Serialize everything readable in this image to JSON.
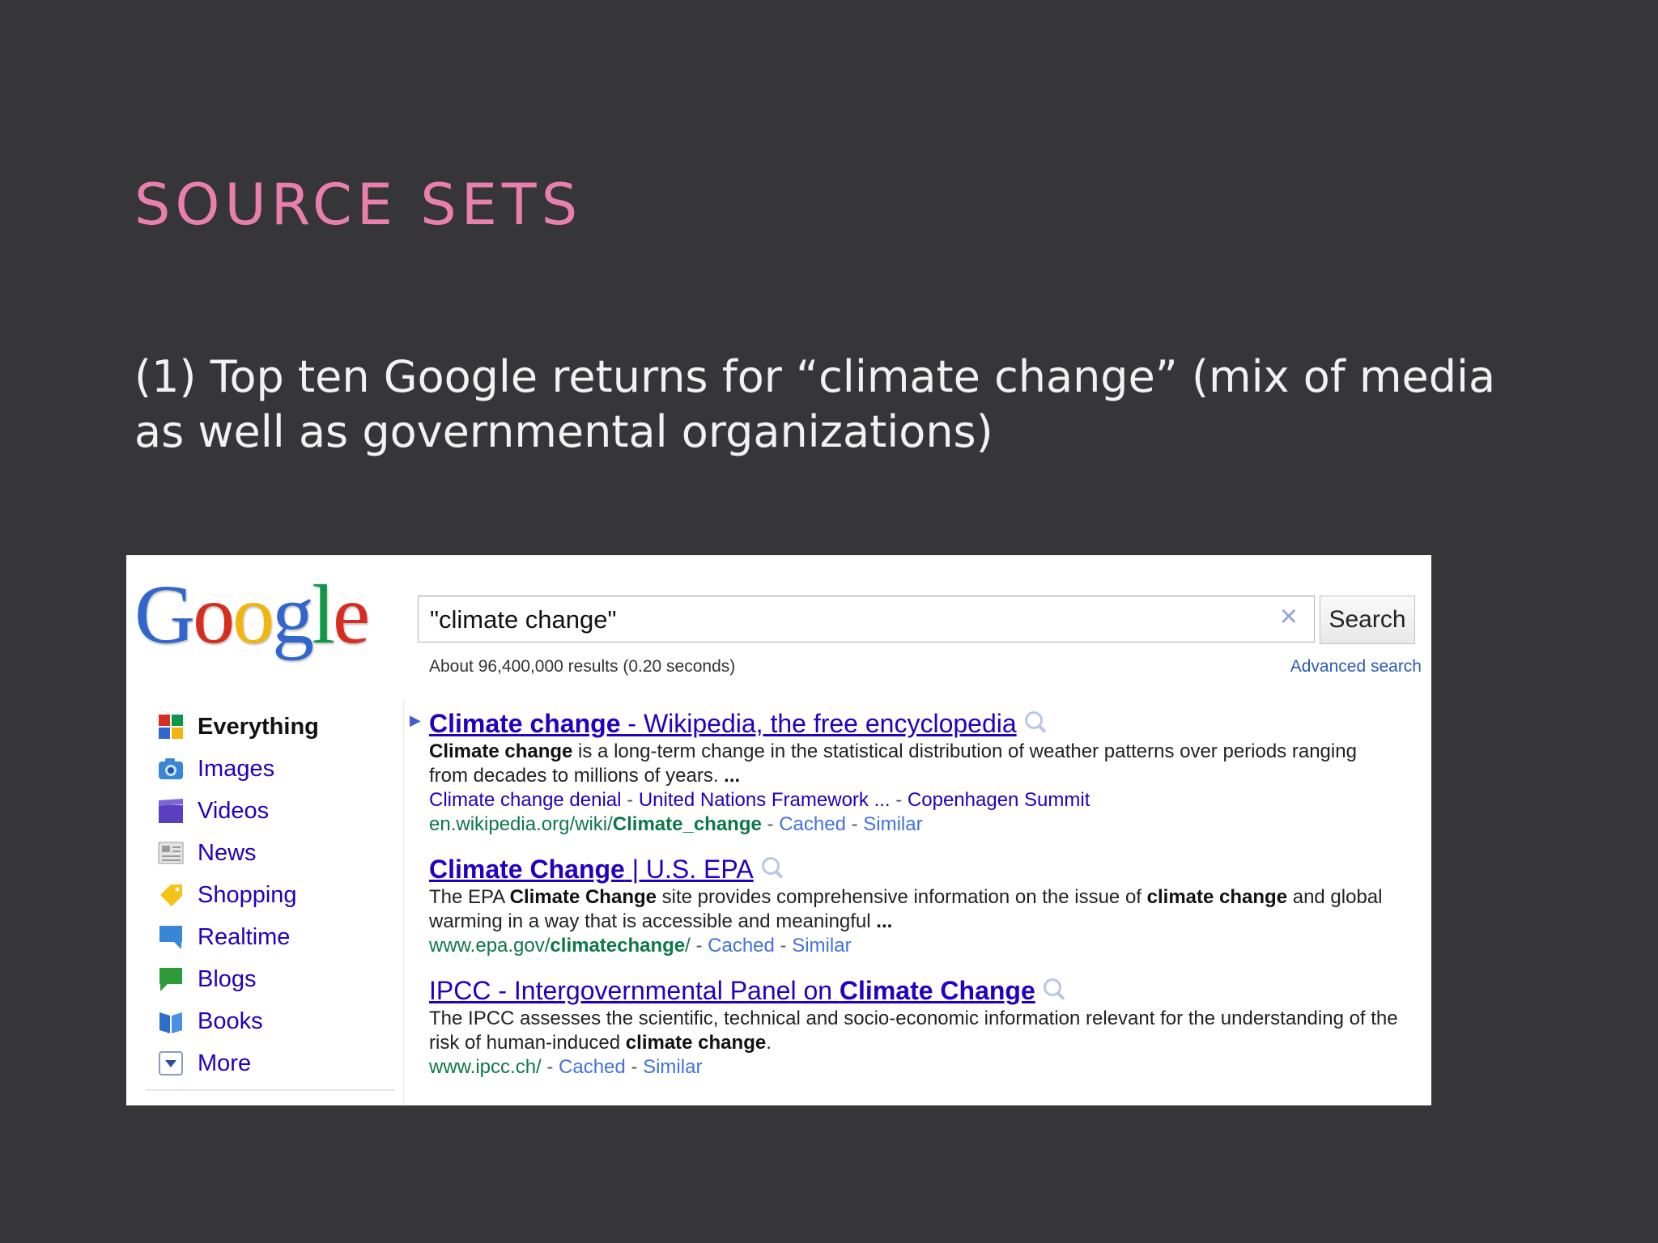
{
  "slide": {
    "title": "SOURCE SETS",
    "body": "(1) Top ten Google returns for “climate change” (mix of  media as well as governmental organizations)"
  },
  "google": {
    "logo": {
      "letters": [
        {
          "char": "G",
          "color": "#3366cc"
        },
        {
          "char": "o",
          "color": "#d62d20"
        },
        {
          "char": "o",
          "color": "#f2b50f"
        },
        {
          "char": "g",
          "color": "#3366cc"
        },
        {
          "char": "l",
          "color": "#109648"
        },
        {
          "char": "e",
          "color": "#d62d20"
        }
      ]
    },
    "search": {
      "query": "\"climate change\"",
      "clear_icon": "×",
      "button_label": "Search"
    },
    "stats": "About 96,400,000 results (0.20 seconds)",
    "advanced_search": "Advanced search",
    "sidebar": {
      "items": [
        {
          "label": "Everything",
          "icon": "everything-icon",
          "active": true
        },
        {
          "label": "Images",
          "icon": "camera-icon"
        },
        {
          "label": "Videos",
          "icon": "film-icon"
        },
        {
          "label": "News",
          "icon": "newspaper-icon"
        },
        {
          "label": "Shopping",
          "icon": "tag-icon"
        },
        {
          "label": "Realtime",
          "icon": "speech-bubble-icon"
        },
        {
          "label": "Blogs",
          "icon": "blog-bubble-icon"
        },
        {
          "label": "Books",
          "icon": "book-icon"
        },
        {
          "label": "More",
          "icon": "dropdown-icon"
        }
      ]
    },
    "results": [
      {
        "title_bold": "Climate change",
        "title_rest": " - Wikipedia, the free encyclopedia",
        "snippet_bold1": "Climate change",
        "snippet_text1": " is a long-term change in the statistical distribution of weather patterns over periods ranging from decades to millions of years. ",
        "snippet_bold2": "...",
        "sitelinks": [
          "Climate change denial",
          "United Nations Framework ...",
          "Copenhagen Summit"
        ],
        "url_plain": "en.wikipedia.org/wiki/",
        "url_bold": "Climate_change",
        "cached": "Cached",
        "similar": "Similar"
      },
      {
        "title_bold": "Climate Change",
        "title_rest": " | U.S. EPA",
        "snippet_text1": "The EPA ",
        "snippet_bold1": "Climate Change",
        "snippet_text2": " site provides comprehensive information on the issue of ",
        "snippet_bold2": "climate change",
        "snippet_text3": " and global warming in a way that is accessible and meaningful ",
        "snippet_bold3": "...",
        "url_plain": "www.epa.gov/",
        "url_bold": "climatechange",
        "url_tail": "/",
        "cached": "Cached",
        "similar": "Similar"
      },
      {
        "title_rest": "IPCC - Intergovernmental Panel on ",
        "title_bold": "Climate Change",
        "snippet_text1": "The IPCC assesses the scientific, technical and socio-economic information relevant for the understanding of the risk of human-induced ",
        "snippet_bold1": "climate change",
        "snippet_text2": ".",
        "url_plain": "www.ipcc.ch/",
        "cached": "Cached",
        "similar": "Similar"
      }
    ]
  }
}
